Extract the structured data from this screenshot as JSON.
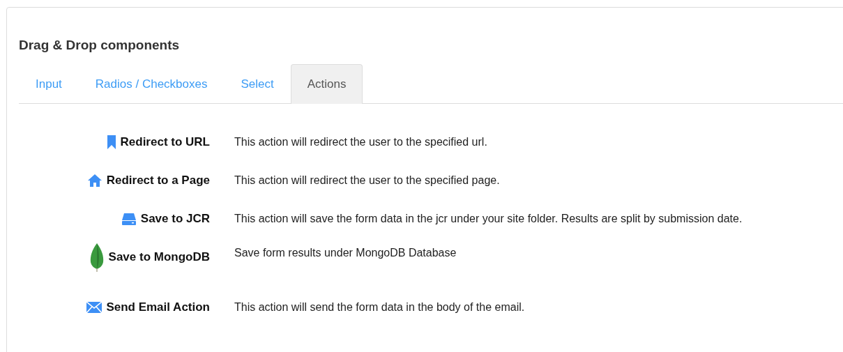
{
  "panel": {
    "title": "Drag & Drop components"
  },
  "tabs": [
    {
      "label": "Input",
      "selected": false
    },
    {
      "label": "Radios / Checkboxes",
      "selected": false
    },
    {
      "label": "Select",
      "selected": false
    },
    {
      "label": "Actions",
      "selected": true
    }
  ],
  "actions": [
    {
      "kind": "bookmark",
      "label": "Redirect to URL",
      "description": "This action will redirect the user to the specified url."
    },
    {
      "kind": "home",
      "label": "Redirect to a Page",
      "description": "This action will redirect the user to the specified page."
    },
    {
      "kind": "drive",
      "label": "Save to JCR",
      "description": "This action will save the form data in the jcr under your site folder. Results are split by submission date."
    },
    {
      "kind": "leaf",
      "label": "Save to MongoDB",
      "description": "Save form results under MongoDB Database"
    },
    {
      "kind": "envelope",
      "label": "Send Email Action",
      "description": "This action will send the form data in the body of the email."
    }
  ]
}
